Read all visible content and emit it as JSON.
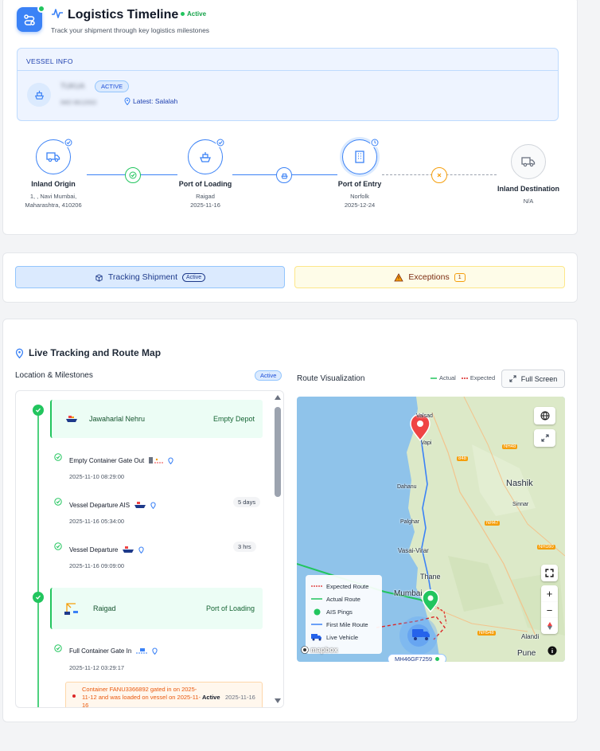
{
  "header": {
    "title": "Logistics Timeline",
    "status": "Active",
    "subtitle": "Track your shipment through key logistics milestones"
  },
  "vessel": {
    "section_label": "VESSEL INFO",
    "name": "TUKUA",
    "badge": "ACTIVE",
    "imo": "IMO 9612002",
    "latest": "Latest: Salalah"
  },
  "steps": [
    {
      "title": "Inland Origin",
      "sub1": "1, , Navi Mumbai,",
      "sub2": "Maharashtra, 410206"
    },
    {
      "title": "Port of Loading",
      "sub1": "Raigad",
      "sub2": "2025-11-16"
    },
    {
      "title": "Port of Entry",
      "sub1": "Norfolk",
      "sub2": "2025-12-24"
    },
    {
      "title": "Inland Destination",
      "sub1": "N/A",
      "sub2": ""
    }
  ],
  "tabs": {
    "tracking_label": "Tracking Shipment",
    "tracking_pill": "Active",
    "exceptions_label": "Exceptions",
    "exceptions_count": "1"
  },
  "live": {
    "title": "Live Tracking and Route Map",
    "milestones_title": "Location & Milestones",
    "milestones_badge": "Active",
    "route_title": "Route Visualization",
    "legend_actual": "Actual",
    "legend_expected": "Expected",
    "fullscreen_label": "Full Screen"
  },
  "milestones": {
    "phase1": {
      "name": "Jawaharlal Nehru",
      "tag": "Empty Depot"
    },
    "events1": [
      {
        "title": "Empty Container Gate Out",
        "date": "2025-11-10 08:29:00",
        "duration": ""
      },
      {
        "title": "Vessel Departure AIS",
        "date": "2025-11-16 05:34:00",
        "duration": "5 days"
      },
      {
        "title": "Vessel Departure",
        "date": "2025-11-16 09:09:00",
        "duration": "3 hrs"
      }
    ],
    "phase2": {
      "name": "Raigad",
      "tag": "Port of Loading"
    },
    "events2": [
      {
        "title": "Full Container Gate In",
        "date": "2025-11-12 03:29:17"
      }
    ],
    "note": {
      "text": "Container FANU3366892 gated in on 2025-11-12 and was loaded on vessel on 2025-11-16",
      "status": "Active",
      "date": "2025-11-16"
    }
  },
  "map": {
    "labels": [
      "Valsad",
      "Vapi",
      "Nashik",
      "Dahanu",
      "Palghar",
      "Vasai-Virar",
      "Thane",
      "Mumbai",
      "Sinnar",
      "Alandi",
      "Pune"
    ],
    "road_labels": [
      "848",
      "NH48",
      "NH47",
      "NH160",
      "NH548"
    ],
    "legend": {
      "expected": "Expected Route",
      "actual": "Actual Route",
      "pings": "AIS Pings",
      "first_mile": "First Mile Route",
      "vehicle": "Live Vehicle"
    },
    "vehicle_plate": "MH46GF7259",
    "attribution": "mapbox"
  },
  "colors": {
    "primary": "#3b82f6",
    "success": "#22c55e",
    "warning": "#f59e0b",
    "expected_route": "#dc2626",
    "water": "#8fc3ea",
    "land": "#dce9c8"
  }
}
